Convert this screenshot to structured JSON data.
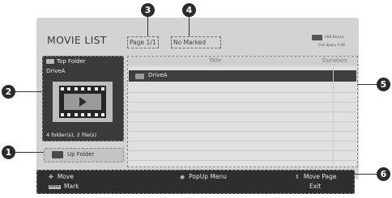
{
  "screen": {
    "title": "MOVIE LIST",
    "page_indicator": "Page 1/1",
    "marked_status": "No Marked",
    "usb_device": {
      "name": "USB Device",
      "free_space": "Free Space 4 GB"
    }
  },
  "sidebar": {
    "top_folder_label": "Top Folder",
    "drive_name": "DriveA",
    "count": "4 folder(s), 2 file(s)"
  },
  "up_folder_label": "Up Folder",
  "list": {
    "columns": [
      "Title",
      "Duration"
    ],
    "rows": [
      {
        "title": "DriveA",
        "duration": "",
        "selected": true
      }
    ]
  },
  "footer": {
    "move": "Move",
    "popup_menu": "PopUp Menu",
    "move_page": "Move Page",
    "mark": "Mark",
    "mark_key": "MARK",
    "exit": "Exit"
  },
  "callouts": [
    "1",
    "2",
    "3",
    "4",
    "5",
    "6"
  ],
  "colors": {
    "panel": "#d3d3d3",
    "dark": "#3b3b3b",
    "footer": "#2e2e2e",
    "selected_row": "#3f3f3f"
  }
}
